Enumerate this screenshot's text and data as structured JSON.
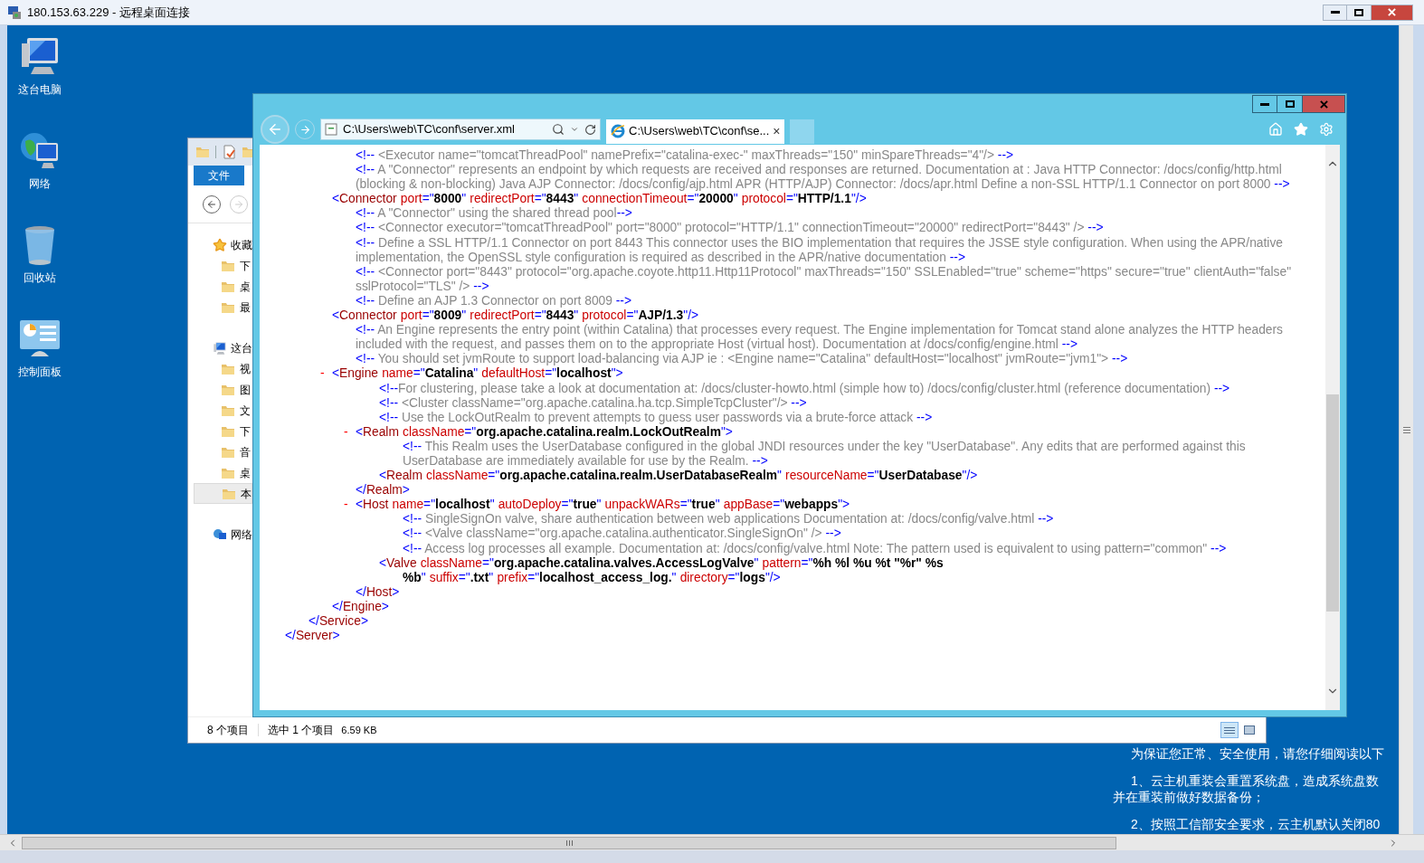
{
  "window": {
    "title": "180.153.63.229 - 远程桌面连接"
  },
  "desktop_icons": [
    {
      "kind": "computer",
      "label": "这台电脑"
    },
    {
      "kind": "network",
      "label": "网络"
    },
    {
      "kind": "recycle-bin",
      "label": "回收站"
    },
    {
      "kind": "control-panel",
      "label": "控制面板"
    }
  ],
  "explorer": {
    "file_tab": "文件",
    "nav": [
      {
        "label": "收藏",
        "selected": false,
        "children": [
          {
            "label": "下",
            "selected": false
          },
          {
            "label": "桌",
            "selected": false
          },
          {
            "label": "最",
            "selected": false
          }
        ]
      },
      {
        "label": "这台",
        "selected": false,
        "children": [
          {
            "label": "视",
            "selected": false
          },
          {
            "label": "图",
            "selected": false
          },
          {
            "label": "文",
            "selected": false
          },
          {
            "label": "下",
            "selected": false
          },
          {
            "label": "音",
            "selected": false
          },
          {
            "label": "桌",
            "selected": false
          },
          {
            "label": "本",
            "selected": true
          }
        ]
      },
      {
        "label": "网络",
        "selected": false
      }
    ],
    "status": {
      "count": "8 个项目",
      "selection": "选中 1 个项目",
      "size": "6.59 KB"
    }
  },
  "browser": {
    "address": "C:\\Users\\web\\TC\\conf\\server.xml",
    "tabs": [
      {
        "title": "C:\\Users\\web\\TC\\conf\\se...",
        "close": "×",
        "selected": true
      }
    ]
  },
  "document": {
    "kind": "element",
    "children": [
      {
        "kind": "element",
        "children": [
          {
            "kind": "comment",
            "open": "<!--",
            "text": " <Executor name=\"tomcatThreadPool\" namePrefix=\"catalina-exec-\" maxThreads=\"150\" minSpareThreads=\"4\"/> ",
            "close": "-->"
          },
          {
            "kind": "comment",
            "open": "<!--",
            "text": " A \"Connector\" represents an endpoint by which requests are received and responses are returned. Documentation at : Java HTTP Connector: /docs/config/http.html (blocking & non-blocking) Java AJP Connector: /docs/config/ajp.html APR (HTTP/AJP) Connector: /docs/apr.html Define a non-SSL HTTP/1.1 Connector on port 8000 ",
            "close": "-->"
          },
          {
            "kind": "element",
            "open": {
              "lt": "<",
              "tag": "Connector",
              "attrs": [
                {
                  "name": "port",
                  "eq": "=\"",
                  "value": "8000",
                  "q": "\""
                },
                {
                  "name": "redirectPort",
                  "eq": "=\"",
                  "value": "8443",
                  "q": "\""
                },
                {
                  "name": "connectionTimeout",
                  "eq": "=\"",
                  "value": "20000",
                  "q": "\""
                },
                {
                  "name": "protocol",
                  "eq": "=\"",
                  "value": "HTTP/1.1",
                  "q": "\""
                }
              ],
              "gt": "/>"
            }
          },
          {
            "kind": "comment",
            "open": "<!--",
            "text": " A \"Connector\" using the shared thread pool",
            "close": "-->"
          },
          {
            "kind": "comment",
            "open": "<!--",
            "text": " <Connector executor=\"tomcatThreadPool\" port=\"8000\" protocol=\"HTTP/1.1\" connectionTimeout=\"20000\" redirectPort=\"8443\" /> ",
            "close": "-->"
          },
          {
            "kind": "comment",
            "open": "<!--",
            "text": " Define a SSL HTTP/1.1 Connector on port 8443 This connector uses the BIO implementation that requires the JSSE style configuration. When using the APR/native implementation, the OpenSSL style configuration is required as described in the APR/native documentation ",
            "close": "-->"
          },
          {
            "kind": "comment",
            "open": "<!--",
            "text": " <Connector port=\"8443\" protocol=\"org.apache.coyote.http11.Http11Protocol\" maxThreads=\"150\" SSLEnabled=\"true\" scheme=\"https\" secure=\"true\" clientAuth=\"false\" sslProtocol=\"TLS\" /> ",
            "close": "-->"
          },
          {
            "kind": "comment",
            "open": "<!--",
            "text": " Define an AJP 1.3 Connector on port 8009 ",
            "close": "-->"
          },
          {
            "kind": "element",
            "open": {
              "lt": "<",
              "tag": "Connector",
              "attrs": [
                {
                  "name": "port",
                  "eq": "=\"",
                  "value": "8009",
                  "q": "\""
                },
                {
                  "name": "redirectPort",
                  "eq": "=\"",
                  "value": "8443",
                  "q": "\""
                },
                {
                  "name": "protocol",
                  "eq": "=\"",
                  "value": "AJP/1.3",
                  "q": "\""
                }
              ],
              "gt": "/>"
            }
          },
          {
            "kind": "comment",
            "open": "<!--",
            "text": " An Engine represents the entry point (within Catalina) that processes every request. The Engine implementation for Tomcat stand alone analyzes the HTTP headers included with the request, and passes them on to the appropriate Host (virtual host). Documentation at /docs/config/engine.html ",
            "close": "-->"
          },
          {
            "kind": "comment",
            "open": "<!--",
            "text": " You should set jvmRoute to support load-balancing via AJP ie : <Engine name=\"Catalina\" defaultHost=\"localhost\" jvmRoute=\"jvm1\"> ",
            "close": "-->"
          },
          {
            "kind": "element",
            "toggle": "-",
            "expanded": true,
            "open": {
              "lt": "<",
              "tag": "Engine",
              "attrs": [
                {
                  "name": "name",
                  "eq": "=\"",
                  "value": "Catalina",
                  "q": "\""
                },
                {
                  "name": "defaultHost",
                  "eq": "=\"",
                  "value": "localhost",
                  "q": "\""
                }
              ],
              "gt": ">"
            },
            "children": [
              {
                "kind": "comment",
                "open": "<!--",
                "text": "For clustering, please take a look at documentation at: /docs/cluster-howto.html (simple how to) /docs/config/cluster.html (reference documentation) ",
                "close": "-->"
              },
              {
                "kind": "comment",
                "open": "<!--",
                "text": " <Cluster className=\"org.apache.catalina.ha.tcp.SimpleTcpCluster\"/> ",
                "close": "-->"
              },
              {
                "kind": "comment",
                "open": "<!--",
                "text": " Use the LockOutRealm to prevent attempts to guess user passwords via a brute-force attack ",
                "close": "-->"
              },
              {
                "kind": "element",
                "toggle": "-",
                "expanded": true,
                "open": {
                  "lt": "<",
                  "tag": "Realm",
                  "attrs": [
                    {
                      "name": "className",
                      "eq": "=\"",
                      "value": "org.apache.catalina.realm.LockOutRealm",
                      "q": "\""
                    }
                  ],
                  "gt": ">"
                },
                "children": [
                  {
                    "kind": "comment",
                    "open": "<!--",
                    "text": " This Realm uses the UserDatabase configured in the global JNDI resources under the key \"UserDatabase\". Any edits that are performed against this UserDatabase are immediately available for use by the Realm. ",
                    "close": "-->"
                  },
                  {
                    "kind": "element",
                    "open": {
                      "lt": "<",
                      "tag": "Realm",
                      "attrs": [
                        {
                          "name": "className",
                          "eq": "=\"",
                          "value": "org.apache.catalina.realm.UserDatabaseRealm",
                          "q": "\""
                        },
                        {
                          "name": "resourceName",
                          "eq": "=\"",
                          "value": "UserDatabase",
                          "q": "\""
                        }
                      ],
                      "gt": "/>"
                    }
                  }
                ],
                "close": {
                  "lt": "</",
                  "tag": "Realm",
                  "gt": ">"
                }
              },
              {
                "kind": "element",
                "toggle": "-",
                "expanded": true,
                "open": {
                  "lt": "<",
                  "tag": "Host",
                  "attrs": [
                    {
                      "name": "name",
                      "eq": "=\"",
                      "value": "localhost",
                      "q": "\""
                    },
                    {
                      "name": "autoDeploy",
                      "eq": "=\"",
                      "value": "true",
                      "q": "\""
                    },
                    {
                      "name": "unpackWARs",
                      "eq": "=\"",
                      "value": "true",
                      "q": "\""
                    },
                    {
                      "name": "appBase",
                      "eq": "=\"",
                      "value": "webapps",
                      "q": "\""
                    }
                  ],
                  "gt": ">"
                },
                "children": [
                  {
                    "kind": "comment",
                    "open": "<!--",
                    "text": " SingleSignOn valve, share authentication between web applications Documentation at: /docs/config/valve.html ",
                    "close": "-->"
                  },
                  {
                    "kind": "comment",
                    "open": "<!--",
                    "text": " <Valve className=\"org.apache.catalina.authenticator.SingleSignOn\" /> ",
                    "close": "-->"
                  },
                  {
                    "kind": "comment",
                    "open": "<!--",
                    "text": " Access log processes all example. Documentation at: /docs/config/valve.html Note: The pattern used is equivalent to using pattern=\"common\" ",
                    "close": "-->"
                  },
                  {
                    "kind": "element",
                    "open": {
                      "lt": "<",
                      "tag": "Valve",
                      "attrs": [
                        {
                          "name": "className",
                          "eq": "=\"",
                          "value": "org.apache.catalina.valves.AccessLogValve",
                          "q": "\""
                        },
                        {
                          "name": "pattern",
                          "eq": "=\"",
                          "value": "%h %l %u %t \"%r\" %s %b",
                          "q": "\""
                        },
                        {
                          "name": "suffix",
                          "eq": "=\"",
                          "value": ".txt",
                          "q": "\""
                        },
                        {
                          "name": "prefix",
                          "eq": "=\"",
                          "value": "localhost_access_log.",
                          "q": "\""
                        },
                        {
                          "name": "directory",
                          "eq": "=\"",
                          "value": "logs",
                          "q": "\""
                        }
                      ],
                      "gt": "/>"
                    }
                  }
                ],
                "close": {
                  "lt": "</",
                  "tag": "Host",
                  "gt": ">"
                }
              }
            ],
            "close": {
              "lt": "</",
              "tag": "Engine",
              "gt": ">"
            }
          }
        ],
        "close": {
          "lt": "</",
          "tag": "Service",
          "gt": ">"
        }
      }
    ],
    "close": {
      "lt": "</",
      "tag": "Server",
      "gt": ">"
    }
  },
  "notice": [
    {
      "lines": [
        "为保证您正常、安全使用，请您仔细阅读以下"
      ]
    },
    {
      "lines": [
        "1、云主机重装会重置系统盘，造成系统盘数",
        "并在重装前做好数据备份；"
      ]
    },
    {
      "lines": [
        "2、按照工信部安全要求，云主机默认关闭80"
      ]
    }
  ]
}
